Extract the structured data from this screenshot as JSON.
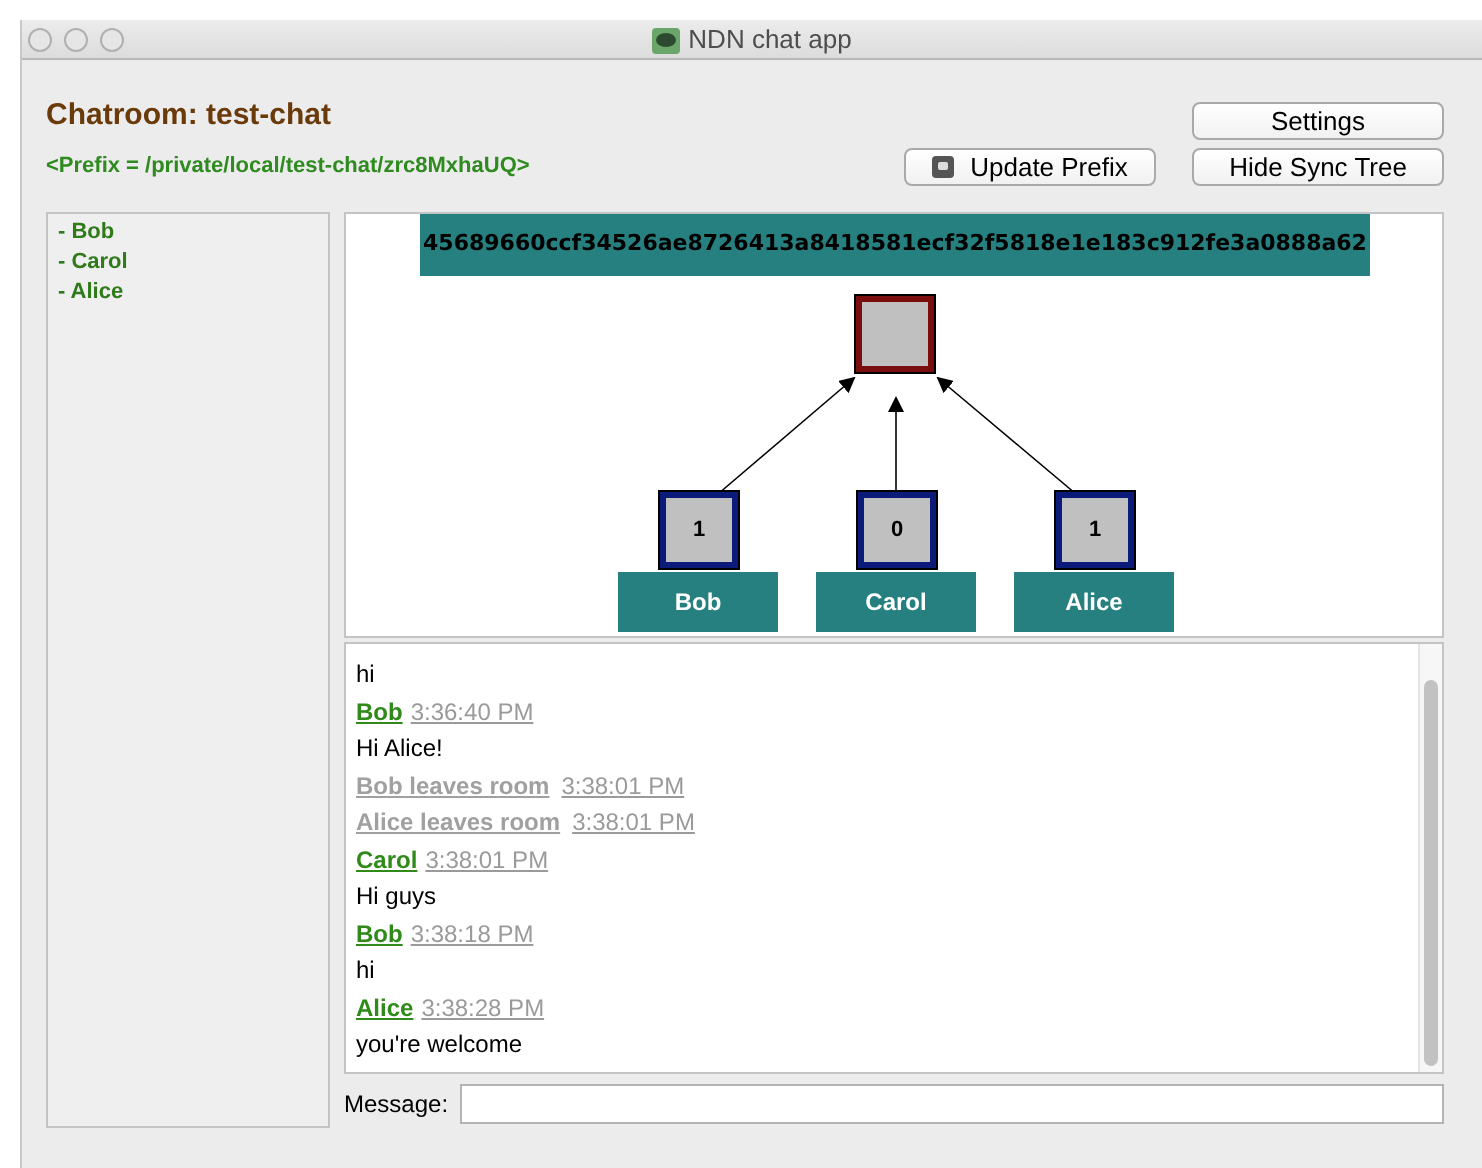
{
  "window": {
    "title": "NDN chat app"
  },
  "chatroom": {
    "title": "Chatroom: test-chat",
    "prefix": "<Prefix = /private/local/test-chat/zrc8MxhaUQ>"
  },
  "buttons": [
    {
      "kind": "settings",
      "label": "Settings"
    },
    {
      "kind": "update",
      "label": "Update Prefix"
    },
    {
      "kind": "hide",
      "label": "Hide Sync Tree"
    }
  ],
  "roster": [
    "- Bob",
    "- Carol",
    "- Alice"
  ],
  "sync_tree": {
    "root_digest": "45689660ccf34526ae8726413a8418581ecf32f5818e1e183c912fe3a0888a62",
    "nodes": [
      {
        "seq": "1",
        "name": "Bob"
      },
      {
        "seq": "0",
        "name": "Carol"
      },
      {
        "seq": "1",
        "name": "Alice"
      }
    ]
  },
  "messages": [
    {
      "kind": "text",
      "text": "hi"
    },
    {
      "kind": "sender",
      "name": "Bob",
      "time": "3:36:40 PM"
    },
    {
      "kind": "text",
      "text": "Hi Alice!"
    },
    {
      "kind": "notice",
      "text": "Bob leaves room",
      "time": "3:38:01 PM"
    },
    {
      "kind": "notice",
      "text": "Alice leaves room",
      "time": "3:38:01 PM"
    },
    {
      "kind": "sender",
      "name": "Carol",
      "time": "3:38:01 PM"
    },
    {
      "kind": "text",
      "text": "Hi guys"
    },
    {
      "kind": "sender",
      "name": "Bob",
      "time": "3:38:18 PM"
    },
    {
      "kind": "text",
      "text": "hi"
    },
    {
      "kind": "sender",
      "name": "Alice",
      "time": "3:38:28 PM"
    },
    {
      "kind": "text",
      "text": "you're welcome"
    }
  ],
  "message_field": {
    "label": "Message:"
  }
}
